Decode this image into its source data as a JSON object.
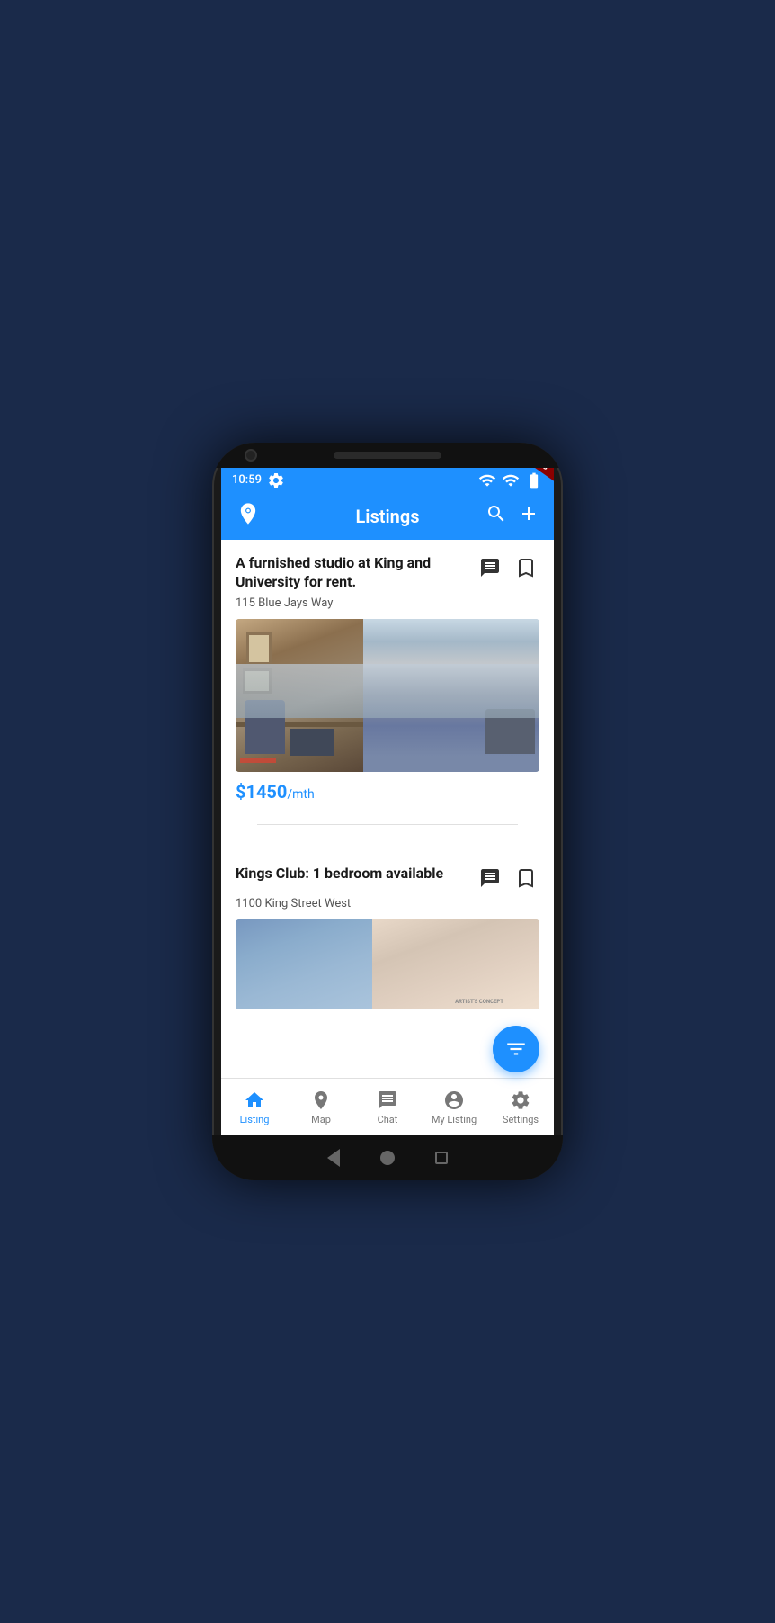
{
  "status_bar": {
    "time": "10:59",
    "debug_label": "DEBUG"
  },
  "app_bar": {
    "title": "Listings",
    "location_icon": "location-pin-icon",
    "search_icon": "search-icon",
    "add_icon": "add-icon"
  },
  "listings": [
    {
      "id": "listing-1",
      "title": "A furnished studio at King and University for rent.",
      "address": "115 Blue Jays Way",
      "price": "$1450",
      "price_unit": "/mth"
    },
    {
      "id": "listing-2",
      "title": "Kings Club: 1 bedroom available",
      "address": "1100 King Street West",
      "price": "",
      "price_unit": ""
    }
  ],
  "bottom_nav": {
    "items": [
      {
        "id": "listing",
        "label": "Listing",
        "active": true
      },
      {
        "id": "map",
        "label": "Map",
        "active": false
      },
      {
        "id": "chat",
        "label": "Chat",
        "active": false
      },
      {
        "id": "my-listing",
        "label": "My Listing",
        "active": false
      },
      {
        "id": "settings",
        "label": "Settings",
        "active": false
      }
    ]
  },
  "fab": {
    "icon": "filter-icon"
  }
}
